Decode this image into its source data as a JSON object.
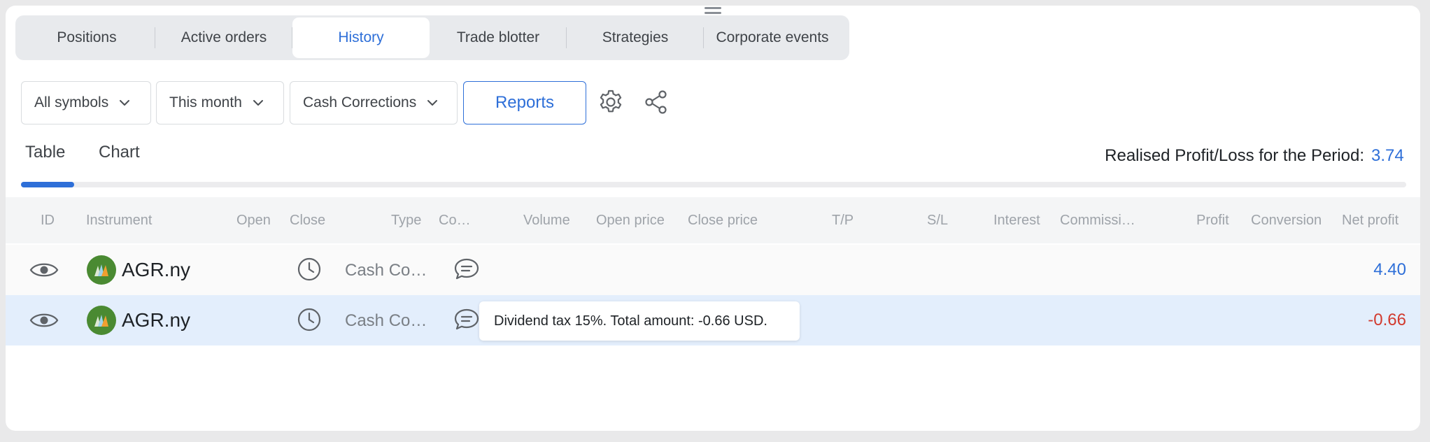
{
  "tabs": [
    {
      "label": "Positions",
      "active": false
    },
    {
      "label": "Active orders",
      "active": false
    },
    {
      "label": "History",
      "active": true
    },
    {
      "label": "Trade blotter",
      "active": false
    },
    {
      "label": "Strategies",
      "active": false
    },
    {
      "label": "Corporate events",
      "active": false
    }
  ],
  "filters": {
    "symbols": "All symbols",
    "period": "This month",
    "type": "Cash Corrections",
    "reports_label": "Reports"
  },
  "icons": {
    "settings": "gear-icon",
    "share": "share-icon",
    "row_view": "eye-icon",
    "time": "clock-icon",
    "comment": "comment-icon",
    "menu": "drag-handle-icon"
  },
  "view_tabs": {
    "table": "Table",
    "chart": "Chart",
    "active": "table"
  },
  "realised": {
    "label": "Realised Profit/Loss for the Period:",
    "value": "3.74"
  },
  "progress": {
    "fraction": 0.0385
  },
  "columns": [
    "ID",
    "Instrument",
    "Open",
    "Close",
    "Type",
    "Co…",
    "Volume",
    "Open price",
    "Close price",
    "T/P",
    "S/L",
    "Interest",
    "Commissi…",
    "Profit",
    "Conversion",
    "Net profit"
  ],
  "rows": [
    {
      "symbol": "AGR.ny",
      "type": "Cash Co…",
      "net_profit": "4.40",
      "selected": false
    },
    {
      "symbol": "AGR.ny",
      "type": "Cash Co…",
      "net_profit": "-0.66",
      "selected": true
    }
  ],
  "tooltip": {
    "text": "Dividend tax 15%. Total amount: -0.66 USD."
  },
  "colors": {
    "accent": "#2e6fd8",
    "negative": "#d23a2e",
    "selected_row": "#e3eefc",
    "logo_green": "#4a8a32"
  }
}
